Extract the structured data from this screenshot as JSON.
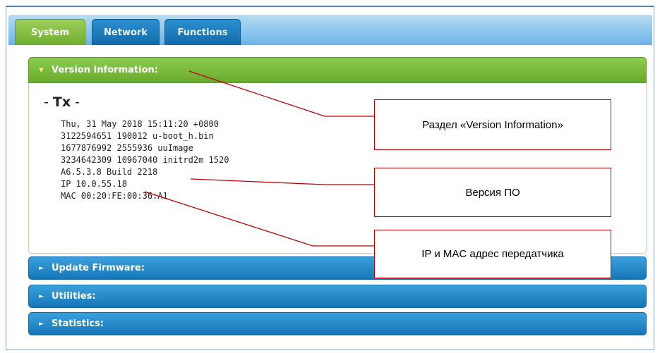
{
  "tabs": [
    {
      "label": "System"
    },
    {
      "label": "Network"
    },
    {
      "label": "Functions"
    }
  ],
  "sections": {
    "version": {
      "title": "Version Information:"
    },
    "update": {
      "title": "Update Firmware:"
    },
    "utilities": {
      "title": "Utilities:"
    },
    "statistics": {
      "title": "Statistics:"
    }
  },
  "tx": {
    "title_prefix": "- ",
    "title_bold": "Tx",
    "title_suffix": " -",
    "lines": [
      "Thu, 31 May 2018 15:11:20 +0800",
      "3122594651 190012 u-boot_h.bin",
      "1677876992 2555936 uuImage",
      "3234642309 10967040 initrd2m 1520",
      "A6.5.3.8 Build 2218",
      "IP 10.0.55.18",
      "MAC 00:20:FE:00:36:A1"
    ]
  },
  "callouts": {
    "version_section": "Раздел «Version Information»",
    "firmware_version": "Версия ПО",
    "ip_mac": "IP и MAC адрес передатчика"
  },
  "colors": {
    "active_tab": "#7ab83a",
    "tab_blue": "#1b7dbf",
    "callout_border": "#c00000"
  },
  "icons": {
    "expanded": "triangle-down-icon",
    "collapsed": "triangle-right-icon"
  }
}
